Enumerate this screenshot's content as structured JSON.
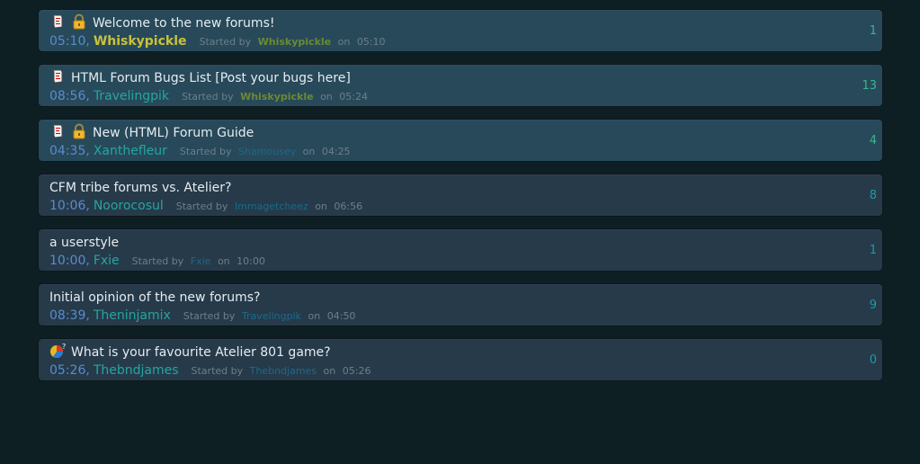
{
  "topics": [
    {
      "title": "Welcome to the new forums!",
      "icons": [
        "scroll-icon",
        "lock-icon"
      ],
      "last_time": "05:10",
      "last_author": "Whiskypickle",
      "last_author_staff": true,
      "started_by_label": "Started by",
      "starter": "Whiskypickle",
      "starter_staff": true,
      "on_label": "on",
      "started_time": "05:10",
      "replies": "1",
      "pinned": true
    },
    {
      "title": "HTML Forum Bugs List [Post your bugs here]",
      "icons": [
        "scroll-icon"
      ],
      "last_time": "08:56",
      "last_author": "Travelingpik",
      "last_author_staff": false,
      "started_by_label": "Started by",
      "starter": "Whiskypickle",
      "starter_staff": true,
      "on_label": "on",
      "started_time": "05:24",
      "replies": "13",
      "pinned": true
    },
    {
      "title": "New (HTML) Forum Guide",
      "icons": [
        "scroll-icon",
        "lock-icon"
      ],
      "last_time": "04:35",
      "last_author": "Xanthefleur",
      "last_author_staff": false,
      "started_by_label": "Started by",
      "starter": "Shamousey",
      "starter_staff": false,
      "on_label": "on",
      "started_time": "04:25",
      "replies": "4",
      "pinned": true
    },
    {
      "title": "CFM tribe forums vs. Atelier?",
      "icons": [],
      "last_time": "10:06",
      "last_author": "Noorocosul",
      "last_author_staff": false,
      "started_by_label": "Started by",
      "starter": "Immagetcheez",
      "starter_staff": false,
      "on_label": "on",
      "started_time": "06:56",
      "replies": "8",
      "pinned": false
    },
    {
      "title": "a userstyle",
      "icons": [],
      "last_time": "10:00",
      "last_author": "Fxie",
      "last_author_staff": false,
      "started_by_label": "Started by",
      "starter": "Fxie",
      "starter_staff": false,
      "on_label": "on",
      "started_time": "10:00",
      "replies": "1",
      "pinned": false
    },
    {
      "title": "Initial opinion of the new forums?",
      "icons": [],
      "last_time": "08:39",
      "last_author": "Theninjamix",
      "last_author_staff": false,
      "started_by_label": "Started by",
      "starter": "Travelingpik",
      "starter_staff": false,
      "on_label": "on",
      "started_time": "04:50",
      "replies": "9",
      "pinned": false
    },
    {
      "title": "What is your favourite Atelier 801 game?",
      "icons": [
        "poll-icon"
      ],
      "last_time": "05:26",
      "last_author": "Thebndjames",
      "last_author_staff": false,
      "started_by_label": "Started by",
      "starter": "Thebndjames",
      "starter_staff": false,
      "on_label": "on",
      "started_time": "05:26",
      "replies": "0",
      "pinned": false
    }
  ],
  "colors": {
    "background": "#0e1f24",
    "pinned_bg": "#27495a",
    "normal_bg": "#263a4a",
    "title": "#e6ecef",
    "time": "#5a8ccc",
    "author": "#24a6a0",
    "staff_author": "#c8c23a",
    "count_pinned": "#3cb58c",
    "count_plain": "#1f9aa4"
  }
}
